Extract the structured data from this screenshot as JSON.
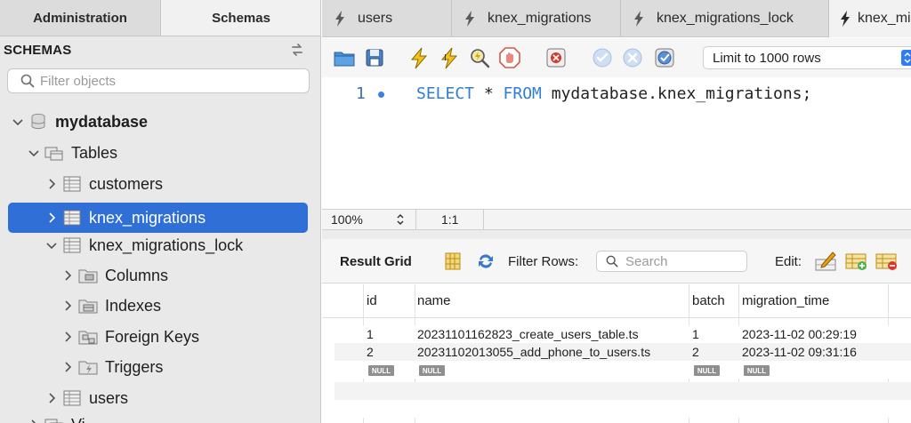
{
  "sidebar": {
    "tabs": [
      {
        "label": "Administration"
      },
      {
        "label": "Schemas"
      }
    ],
    "header": "SCHEMAS",
    "filter_placeholder": "Filter objects",
    "tree": [
      {
        "label": "mydatabase"
      },
      {
        "label": "Tables"
      },
      {
        "label": "customers"
      },
      {
        "label": "knex_migrations"
      },
      {
        "label": "knex_migrations_lock"
      },
      {
        "label": "Columns"
      },
      {
        "label": "Indexes"
      },
      {
        "label": "Foreign Keys"
      },
      {
        "label": "Triggers"
      },
      {
        "label": "users"
      },
      {
        "label": "Vi"
      }
    ]
  },
  "query_tabs": [
    {
      "label": "users"
    },
    {
      "label": "knex_migrations"
    },
    {
      "label": "knex_migrations_lock"
    },
    {
      "label": "knex_mig"
    }
  ],
  "editor": {
    "limit_label": "Limit to 1000 rows",
    "line_number": "1",
    "code": {
      "kw1": "SELECT",
      "star": " * ",
      "kw2": "FROM",
      "rest": " mydatabase.knex_migrations;"
    }
  },
  "status_bar": {
    "zoom": "100%",
    "position": "1:1"
  },
  "result_toolbar": {
    "title": "Result Grid",
    "filter_label": "Filter Rows:",
    "search_placeholder": "Search",
    "edit_label": "Edit:"
  },
  "result_grid": {
    "columns": [
      "id",
      "name",
      "batch",
      "migration_time"
    ],
    "rows": [
      [
        "1",
        "20231101162823_create_users_table.ts",
        "1",
        "2023-11-02 00:29:19"
      ],
      [
        "2",
        "20231102013055_add_phone_to_users.ts",
        "2",
        "2023-11-02 09:31:16"
      ]
    ],
    "null_label": "NULL"
  },
  "colors": {
    "selection": "#2f6fd6",
    "keyword": "#2f7fd1",
    "accent": "#2f7cf6"
  }
}
